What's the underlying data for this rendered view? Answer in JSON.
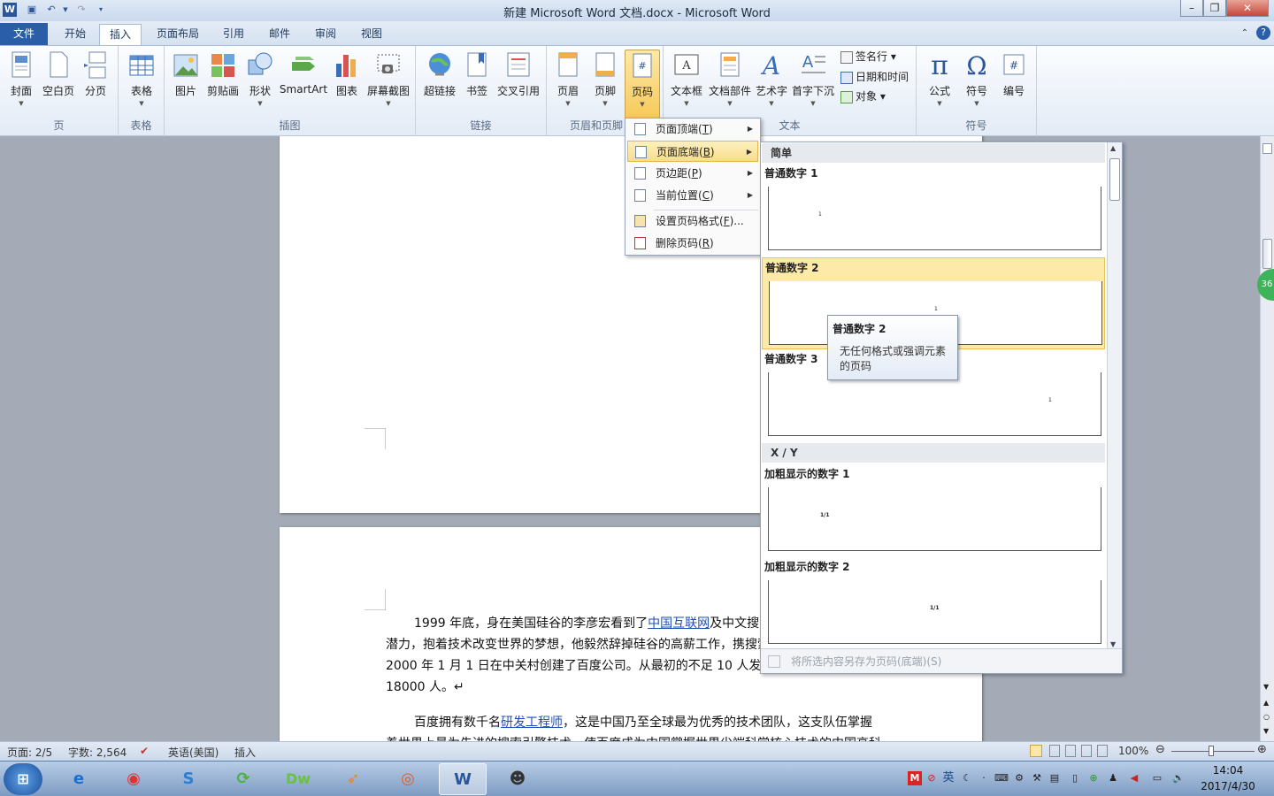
{
  "window": {
    "title": "新建 Microsoft Word 文档.docx  -  Microsoft Word",
    "app_icon": "W"
  },
  "tabs": {
    "file": "文件",
    "items": [
      "开始",
      "插入",
      "页面布局",
      "引用",
      "邮件",
      "审阅",
      "视图"
    ],
    "active": "插入"
  },
  "ribbon": {
    "groups": {
      "page": "页",
      "table": "表格",
      "illustrations": "插图",
      "links": "链接",
      "header_footer": "页眉和页脚",
      "text": "文本",
      "symbols": "符号"
    },
    "buttons": {
      "cover": "封面",
      "blank": "空白页",
      "break": "分页",
      "table": "表格",
      "picture": "图片",
      "clipart": "剪贴画",
      "shapes": "形状",
      "smartart": "SmartArt",
      "chart": "图表",
      "screenshot": "屏幕截图",
      "hyperlink": "超链接",
      "bookmark": "书签",
      "crossref": "交叉引用",
      "header": "页眉",
      "footer": "页脚",
      "pagenum": "页码",
      "textbox": "文本框",
      "quickparts": "文档部件",
      "wordart": "艺术字",
      "dropcap": "首字下沉",
      "signature": "签名行",
      "datetime": "日期和时间",
      "object": "对象",
      "equation": "公式",
      "symbol": "符号",
      "number": "编号"
    }
  },
  "menu": {
    "items": [
      {
        "label": "页面顶端(",
        "key": "T",
        "suffix": ")",
        "submenu": true
      },
      {
        "label": "页面底端(",
        "key": "B",
        "suffix": ")",
        "submenu": true
      },
      {
        "label": "页边距(",
        "key": "P",
        "suffix": ")",
        "submenu": true
      },
      {
        "label": "当前位置(",
        "key": "C",
        "suffix": ")",
        "submenu": true
      },
      {
        "label": "设置页码格式(",
        "key": "F",
        "suffix": ")...",
        "submenu": false
      },
      {
        "label": "删除页码(",
        "key": "R",
        "suffix": ")",
        "submenu": false
      }
    ]
  },
  "gallery": {
    "section1": "简单",
    "section2": "X / Y",
    "items": [
      {
        "title": "普通数字 1",
        "sample": "1"
      },
      {
        "title": "普通数字 2",
        "sample": "1"
      },
      {
        "title": "普通数字 3",
        "sample": "1"
      },
      {
        "title": "加粗显示的数字 1",
        "sample": "1/1"
      },
      {
        "title": "加粗显示的数字 2",
        "sample": "1/1"
      }
    ],
    "footer": "将所选内容另存为页码(底端)(S)"
  },
  "tooltip": {
    "title": "普通数字 2",
    "body": "无任何格式或强调元素的页码"
  },
  "document": {
    "p1_line1_a": "1999 年底，身在美国硅谷的李彦宏看到了",
    "p1_link1": "中国互联网",
    "p1_line1_b": "及中文搜索",
    "p1_line2": "潜力，抱着技术改变世界的梦想，他毅然辞掉硅谷的高薪工作，携搜索",
    "p1_line3": "2000 年 1 月 1 日在中关村创建了百度公司。从最初的不足 10 人发展",
    "p1_line4": "18000 人。↵",
    "p2_line1_a": "百度拥有数千名",
    "p2_link": "研发工程师",
    "p2_line1_b": "，这是中国乃至全球最为优秀的技术团队，这支队伍掌握",
    "p2_line2": "着世界上最为先进的搜索引擎技术，使百度成为中国掌握世界尖端科学核心技术的中国高科"
  },
  "status": {
    "page": "页面: 2/5",
    "words": "字数: 2,564",
    "lang": "英语(美国)",
    "mode": "插入",
    "zoom": "100%"
  },
  "taskbar": {
    "clock_time": "14:04",
    "clock_date": "2017/4/30",
    "ime": "英"
  }
}
